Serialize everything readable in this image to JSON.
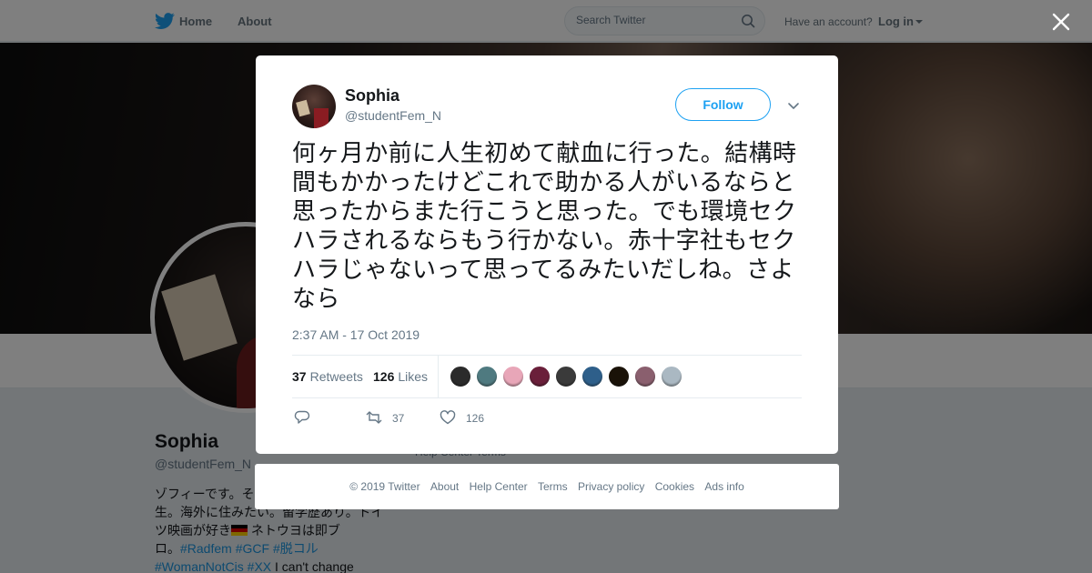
{
  "nav": {
    "home": "Home",
    "about": "About",
    "search_placeholder": "Search Twitter",
    "have_account": "Have an account?",
    "login": "Log in"
  },
  "profile": {
    "name": "Sophia",
    "handle": "@studentFem_N",
    "bio_line1": "ゾフィーです。そ",
    "bio_line2": "生。海外に住みたい。留学歴あり。ドイ",
    "bio_line3_a": "ツ映画が好き",
    "bio_line3_b": " ネトウヨは即ブ",
    "bio_line4_a": "ロ。",
    "bio_tags1": [
      "#Radfem",
      "#GCF",
      "#脱コル"
    ],
    "bio_tags2": [
      "#WomanNotCis",
      "#XX"
    ],
    "bio_line5_tail": " I can't change",
    "footer_hint": "Help Center   Terms"
  },
  "tweet": {
    "name": "Sophia",
    "handle": "@studentFem_N",
    "follow": "Follow",
    "text": "何ヶ月か前に人生初めて献血に行った。結構時間もかかったけどこれで助かる人がいるならと思ったからまた行こうと思った。でも環境セクハラされるならもう行かない。赤十字社もセクハラじゃないって思ってるみたいだしね。さよなら",
    "time": "2:37 AM - 17 Oct 2019",
    "retweets_count": "37",
    "retweets_label": "Retweets",
    "likes_count": "126",
    "likes_label": "Likes",
    "liker_colors": [
      "#2b2b2b",
      "#4f7a80",
      "#e8a6b8",
      "#6a1f3a",
      "#3a3a3a",
      "#2e5f8a",
      "#1a1208",
      "#8a5f6e",
      "#aab8c2"
    ],
    "reply_count": "",
    "retweet_action_count": "37",
    "like_action_count": "126"
  },
  "footer": {
    "links": [
      "© 2019 Twitter",
      "About",
      "Help Center",
      "Terms",
      "Privacy policy",
      "Cookies",
      "Ads info"
    ]
  },
  "colors": {
    "accent": "#1da1f2",
    "link": "#1b95e0",
    "muted": "#657786"
  }
}
